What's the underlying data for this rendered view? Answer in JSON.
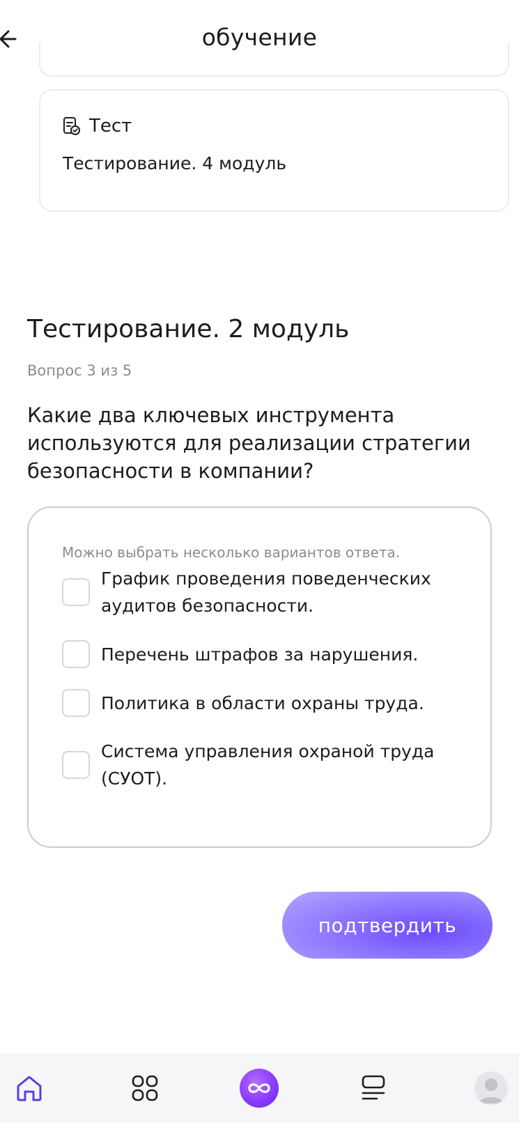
{
  "header": {
    "title": "обучение"
  },
  "test_card": {
    "type_label": "Тест",
    "title": "Тестирование. 4 модуль"
  },
  "quiz": {
    "title": "Тестирование. 2 модуль",
    "progress": "Вопрос 3 из 5",
    "question": "Какие два ключевых инструмента используются для реализации стратегии безопасности в компании?",
    "hint": "Можно выбрать несколько вариантов ответа.",
    "options": [
      {
        "label": "График проведения поведенческих аудитов безопасности.",
        "checked": false
      },
      {
        "label": "Перечень штрафов за нарушения.",
        "checked": false
      },
      {
        "label": "Политика в области охраны труда.",
        "checked": false
      },
      {
        "label": "Система управления охраной труда (СУОТ).",
        "checked": false
      }
    ],
    "confirm_label": "подтвердить"
  },
  "bottom_nav": {
    "items": [
      {
        "icon": "home-icon",
        "active": true
      },
      {
        "icon": "grid-icon",
        "active": false
      },
      {
        "icon": "infinity-icon",
        "active": false
      },
      {
        "icon": "list-icon",
        "active": false
      },
      {
        "icon": "avatar",
        "active": false
      }
    ]
  },
  "colors": {
    "accent": "#7b5cff",
    "nav_center": "#8a3dff",
    "text_primary": "#1c1c1c",
    "text_secondary": "#8a8c92",
    "border": "#c9cbd1",
    "nav_bg": "#f6f6f8"
  }
}
